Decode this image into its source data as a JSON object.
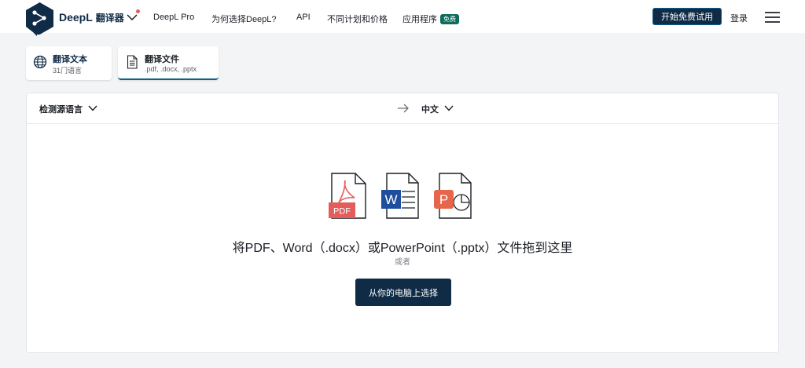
{
  "nav": {
    "brand": "DeepL",
    "brand_sub": "翻译器",
    "items": [
      {
        "label": "DeepL Pro"
      },
      {
        "label": "为何选择DeepL?"
      },
      {
        "label": "API"
      },
      {
        "label": "不同计划和价格"
      },
      {
        "label": "应用程序",
        "badge": "免费"
      }
    ],
    "trial_button": "开始免费试用",
    "login": "登录"
  },
  "tabs": [
    {
      "title": "翻译文本",
      "subtitle": "31门语言",
      "icon": "globe-icon"
    },
    {
      "title": "翻译文件",
      "subtitle": ".pdf, .docx, .pptx",
      "icon": "document-icon",
      "active": true
    }
  ],
  "languages": {
    "source": "检测源语言",
    "target": "中文"
  },
  "dropzone": {
    "file_types": [
      "PDF",
      "W",
      "P"
    ],
    "instruction": "将PDF、Word（.docx）或PowerPoint（.pptx）文件拖到这里",
    "or": "或者",
    "choose_button": "从你的电脑上选择"
  },
  "colors": {
    "navy": "#0f2b46",
    "pdf_red": "#e35d5b",
    "word_blue": "#1f4e9e",
    "ppt_orange": "#e6654b",
    "free_badge": "#0f6b5c"
  }
}
